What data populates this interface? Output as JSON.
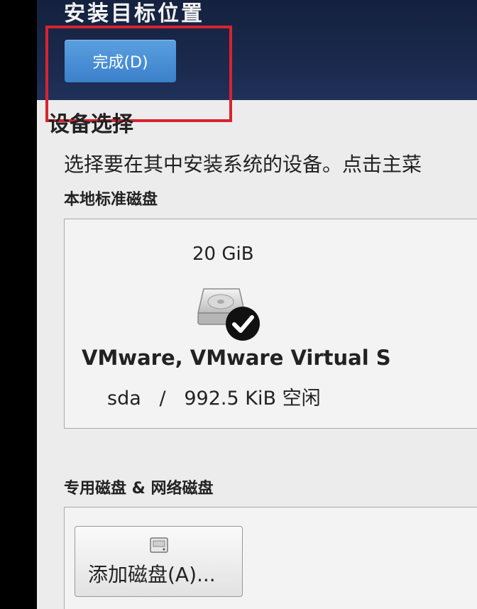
{
  "header": {
    "title": "安装目标位置",
    "done_button": "完成(D)"
  },
  "device_selection": {
    "title": "设备选择",
    "description": "选择要在其中安装系统的设备。点击主菜"
  },
  "local_disks": {
    "label": "本地标准磁盘",
    "disk": {
      "size": "20 GiB",
      "name": "VMware, VMware Virtual S",
      "device": "sda",
      "separator": "/",
      "free": "992.5 KiB 空闲",
      "selected": true,
      "icon": "harddisk-icon",
      "check_icon": "checkmark-icon"
    }
  },
  "network_disks": {
    "label": "专用磁盘 & 网络磁盘",
    "add_button": "添加磁盘(A)...",
    "add_icon": "disk-small-icon"
  },
  "colors": {
    "header_bg": "#1b2a4e",
    "button_blue": "#4a8fd6",
    "highlight_red": "#d9232d"
  }
}
